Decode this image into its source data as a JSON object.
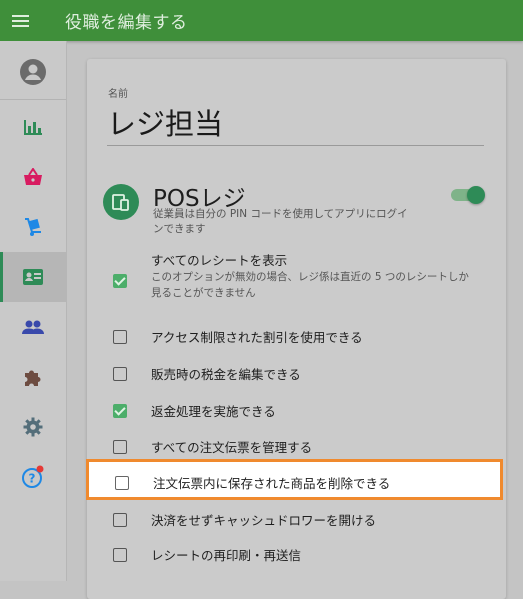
{
  "header": {
    "title": "役職を編集する"
  },
  "sidebar": {
    "items": [
      {
        "name": "account-icon"
      },
      {
        "name": "reports-icon"
      },
      {
        "name": "items-icon"
      },
      {
        "name": "inventory-icon"
      },
      {
        "name": "employees-icon",
        "active": true
      },
      {
        "name": "customers-icon"
      },
      {
        "name": "apps-icon"
      },
      {
        "name": "settings-icon"
      },
      {
        "name": "help-icon"
      }
    ],
    "colors": {
      "accent": "#2e8b57",
      "reports": "#2e8b57",
      "items": "#d81b60",
      "inventory": "#1e88e5",
      "customers": "#3949ab",
      "apps": "#6d4c41",
      "settings": "#546e7a",
      "help": "#1e88e5",
      "badge": "#e53935"
    }
  },
  "form": {
    "name_label": "名前",
    "name_value": "レジ担当"
  },
  "pos": {
    "title": "POSレジ",
    "description": "従業員は自分の PIN コードを使用してアプリにログインできます",
    "toggle_on": true
  },
  "permissions": [
    {
      "label": "すべてのレシートを表示",
      "description": "このオプションが無効の場合、レジ係は直近の 5 つのレシートしか見ることができません",
      "checked": true
    },
    {
      "label": "アクセス制限された割引を使用できる",
      "checked": false
    },
    {
      "label": "販売時の税金を編集できる",
      "checked": false
    },
    {
      "label": "返金処理を実施できる",
      "checked": true
    },
    {
      "label": "すべての注文伝票を管理する",
      "checked": false
    },
    {
      "label": "注文伝票内に保存された商品を削除できる",
      "checked": false,
      "highlighted": true
    },
    {
      "label": "決済をせずキャッシュドロワーを開ける",
      "checked": false
    },
    {
      "label": "レシートの再印刷・再送信",
      "checked": false
    }
  ],
  "colors": {
    "appbar": "#3f8f3a",
    "highlight_border": "#f08a2e",
    "check": "#4cae6a"
  }
}
